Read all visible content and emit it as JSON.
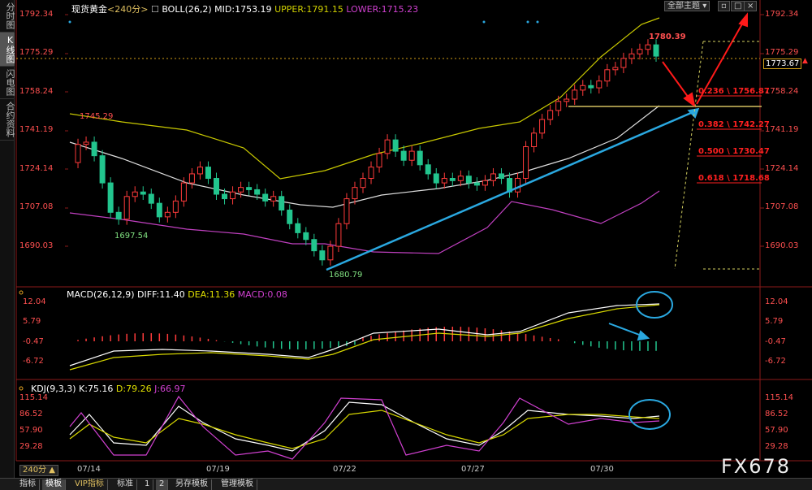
{
  "sidebar": {
    "tabs": [
      "分时图",
      "K线图",
      "闪电图",
      "合约资料"
    ],
    "active_index": 1
  },
  "header": {
    "symbol": "现货黄金",
    "period_tag": "<240分>",
    "boll": "BOLL(26,2)",
    "mid": "MID:1753.19",
    "upper": "UPPER:1791.15",
    "lower": "LOWER:1715.23"
  },
  "topright": {
    "theme_button": "全部主题",
    "arrow_icon": "chevron-down-icon"
  },
  "price_axis": {
    "ticks": [
      "1792.34",
      "1775.29",
      "1758.24",
      "1741.19",
      "1724.14",
      "1707.08",
      "1690.03"
    ],
    "current_price": "1773.67"
  },
  "annotations": {
    "high_label": "1780.39",
    "left_high": "1745.29",
    "left_low": "1697.54",
    "low": "1680.79",
    "fib": [
      {
        "label": "0.236 \\ 1756.87"
      },
      {
        "label": "0.382 \\ 1742.27"
      },
      {
        "label": "0.500 \\ 1730.47"
      },
      {
        "label": "0.618 \\ 1718.68"
      }
    ]
  },
  "macd": {
    "title": "MACD(26,12,9)",
    "diff": "DIFF:11.40",
    "dea": "DEA:11.36",
    "macd": "MACD:0.08",
    "ticks": [
      "12.04",
      "5.79",
      "-0.47",
      "-6.72"
    ]
  },
  "kdj": {
    "title": "KDJ(9,3,3)",
    "k": "K:75.16",
    "d": "D:79.26",
    "j": "J:66.97",
    "ticks": [
      "115.14",
      "86.52",
      "57.90",
      "29.28"
    ]
  },
  "xaxis": {
    "period": "240分",
    "dates": [
      "07/14",
      "07/19",
      "07/22",
      "07/27",
      "07/30"
    ]
  },
  "bottom_tabs": [
    "指标",
    "模板",
    "VIP指标",
    "标准",
    "1",
    "2",
    "另存模板",
    "管理模板"
  ],
  "bottom_active": 1,
  "watermark": "FX678",
  "colors": {
    "up": "#ff3b3b",
    "down": "#22c58e",
    "boll_upper": "#c8c800",
    "boll_mid": "#dddddd",
    "boll_lower": "#c040c0",
    "fib": "#ff2020",
    "trend": "#2aa8e0"
  }
}
